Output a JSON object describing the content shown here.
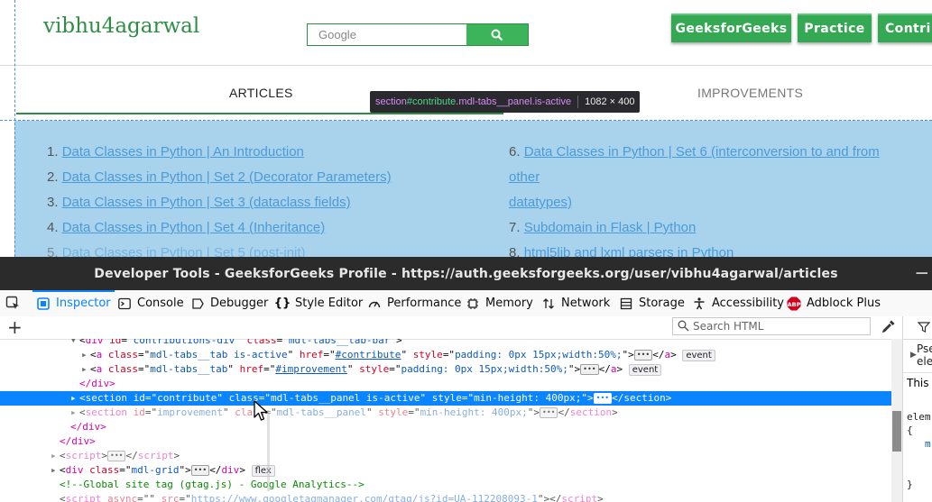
{
  "site": {
    "username": "vibhu4agarwal",
    "search_placeholder": "Google",
    "buttons": [
      "GeeksforGeeks",
      "Practice",
      "Contri"
    ],
    "colors": {
      "brand_green": "#2f8d46",
      "button_green": "#34a853",
      "highlight": "#a9d3ec",
      "link": "#4a9bd9"
    }
  },
  "tabs": {
    "articles": "ARTICLES",
    "improvements": "IMPROVEMENTS"
  },
  "tooltip": {
    "tag": "section",
    "id": "#contribute",
    "classes": ".mdl-tabs__panel.is-active",
    "dimensions": "1082 × 400"
  },
  "articles": {
    "left": [
      {
        "num": "1.",
        "title": "Data Classes in Python | An Introduction"
      },
      {
        "num": "2.",
        "title": "Data Classes in Python | Set 2 (Decorator Parameters)"
      },
      {
        "num": "3.",
        "title": "Data Classes in Python | Set 3 (dataclass fields)"
      },
      {
        "num": "4.",
        "title": "Data Classes in Python | Set 4 (Inheritance)"
      },
      {
        "num": "5.",
        "title": "Data Classes in Python | Set 5 (post-init)"
      }
    ],
    "right": [
      {
        "num": "6.",
        "title_line1": "Data Classes in Python | Set 6 (interconversion to and from other",
        "title_line2": "datatypes)"
      },
      {
        "num": "7.",
        "title": "Subdomain in Flask | Python"
      },
      {
        "num": "8.",
        "title": "html5lib and lxml parsers in Python"
      }
    ]
  },
  "devtools": {
    "title": "Developer Tools - GeeksforGeeks Profile - https://auth.geeksforgeeks.org/user/vibhu4agarwal/articles",
    "tabs": [
      {
        "label": "Inspector",
        "icon": "inspector-icon"
      },
      {
        "label": "Console",
        "icon": "console-icon"
      },
      {
        "label": "Debugger",
        "icon": "debugger-icon"
      },
      {
        "label": "Style Editor",
        "icon": "style-editor-icon"
      },
      {
        "label": "Performance",
        "icon": "performance-icon"
      },
      {
        "label": "Memory",
        "icon": "memory-icon"
      },
      {
        "label": "Network",
        "icon": "network-icon"
      },
      {
        "label": "Storage",
        "icon": "storage-icon"
      },
      {
        "label": "Accessibility",
        "icon": "accessibility-icon"
      },
      {
        "label": "Adblock Plus",
        "icon": "adblock-icon"
      }
    ],
    "search_placeholder": "Search HTML",
    "sidebar": {
      "pseudo_line1": "Pse",
      "pseudo_line2": "ele",
      "this_label": "This E",
      "elem_label": "elem",
      "brace_open": "{",
      "prop": "m",
      "brace_close": "}"
    },
    "markup": {
      "l1_tag": "div",
      "l1_id_attr": "id",
      "l1_id": "contributions-div",
      "l1_class_attr": "class",
      "l1_class": "mdl-tabs__tab-bar",
      "l2_tag": "a",
      "l2_class": "mdl-tabs__tab is-active",
      "l2_href": "#contribute",
      "l2_style": "padding: 0px 15px;width:50%;",
      "l2_badge": "event",
      "l3_tag": "a",
      "l3_class": "mdl-tabs__tab",
      "l3_href": "#improvement",
      "l3_style": "padding: 0px 15px;width:50%;",
      "l3_badge": "event",
      "l4_close": "</div>",
      "l5_tag": "section",
      "l5_id": "contribute",
      "l5_class": "mdl-tabs__panel is-active",
      "l5_style": "min-height: 400px;",
      "l6_tag": "section",
      "l6_id": "improvement",
      "l6_class": "mdl-tabs__panel",
      "l6_style": "min-height: 400px;",
      "l7_close": "</div>",
      "l8_close": "</div>",
      "l9_tag": "script",
      "l10_tag": "div",
      "l10_class": "mdl-grid",
      "l10_badge": "flex",
      "l11_comment": "<!--Global site tag (gtag.js) - Google Analytics-->",
      "l12_tag": "script",
      "l12_async_attr": "async",
      "l12_async": "",
      "l12_src": "https://www.googletagmanager.com/gtag/js?id=UA-112208093-1"
    }
  }
}
